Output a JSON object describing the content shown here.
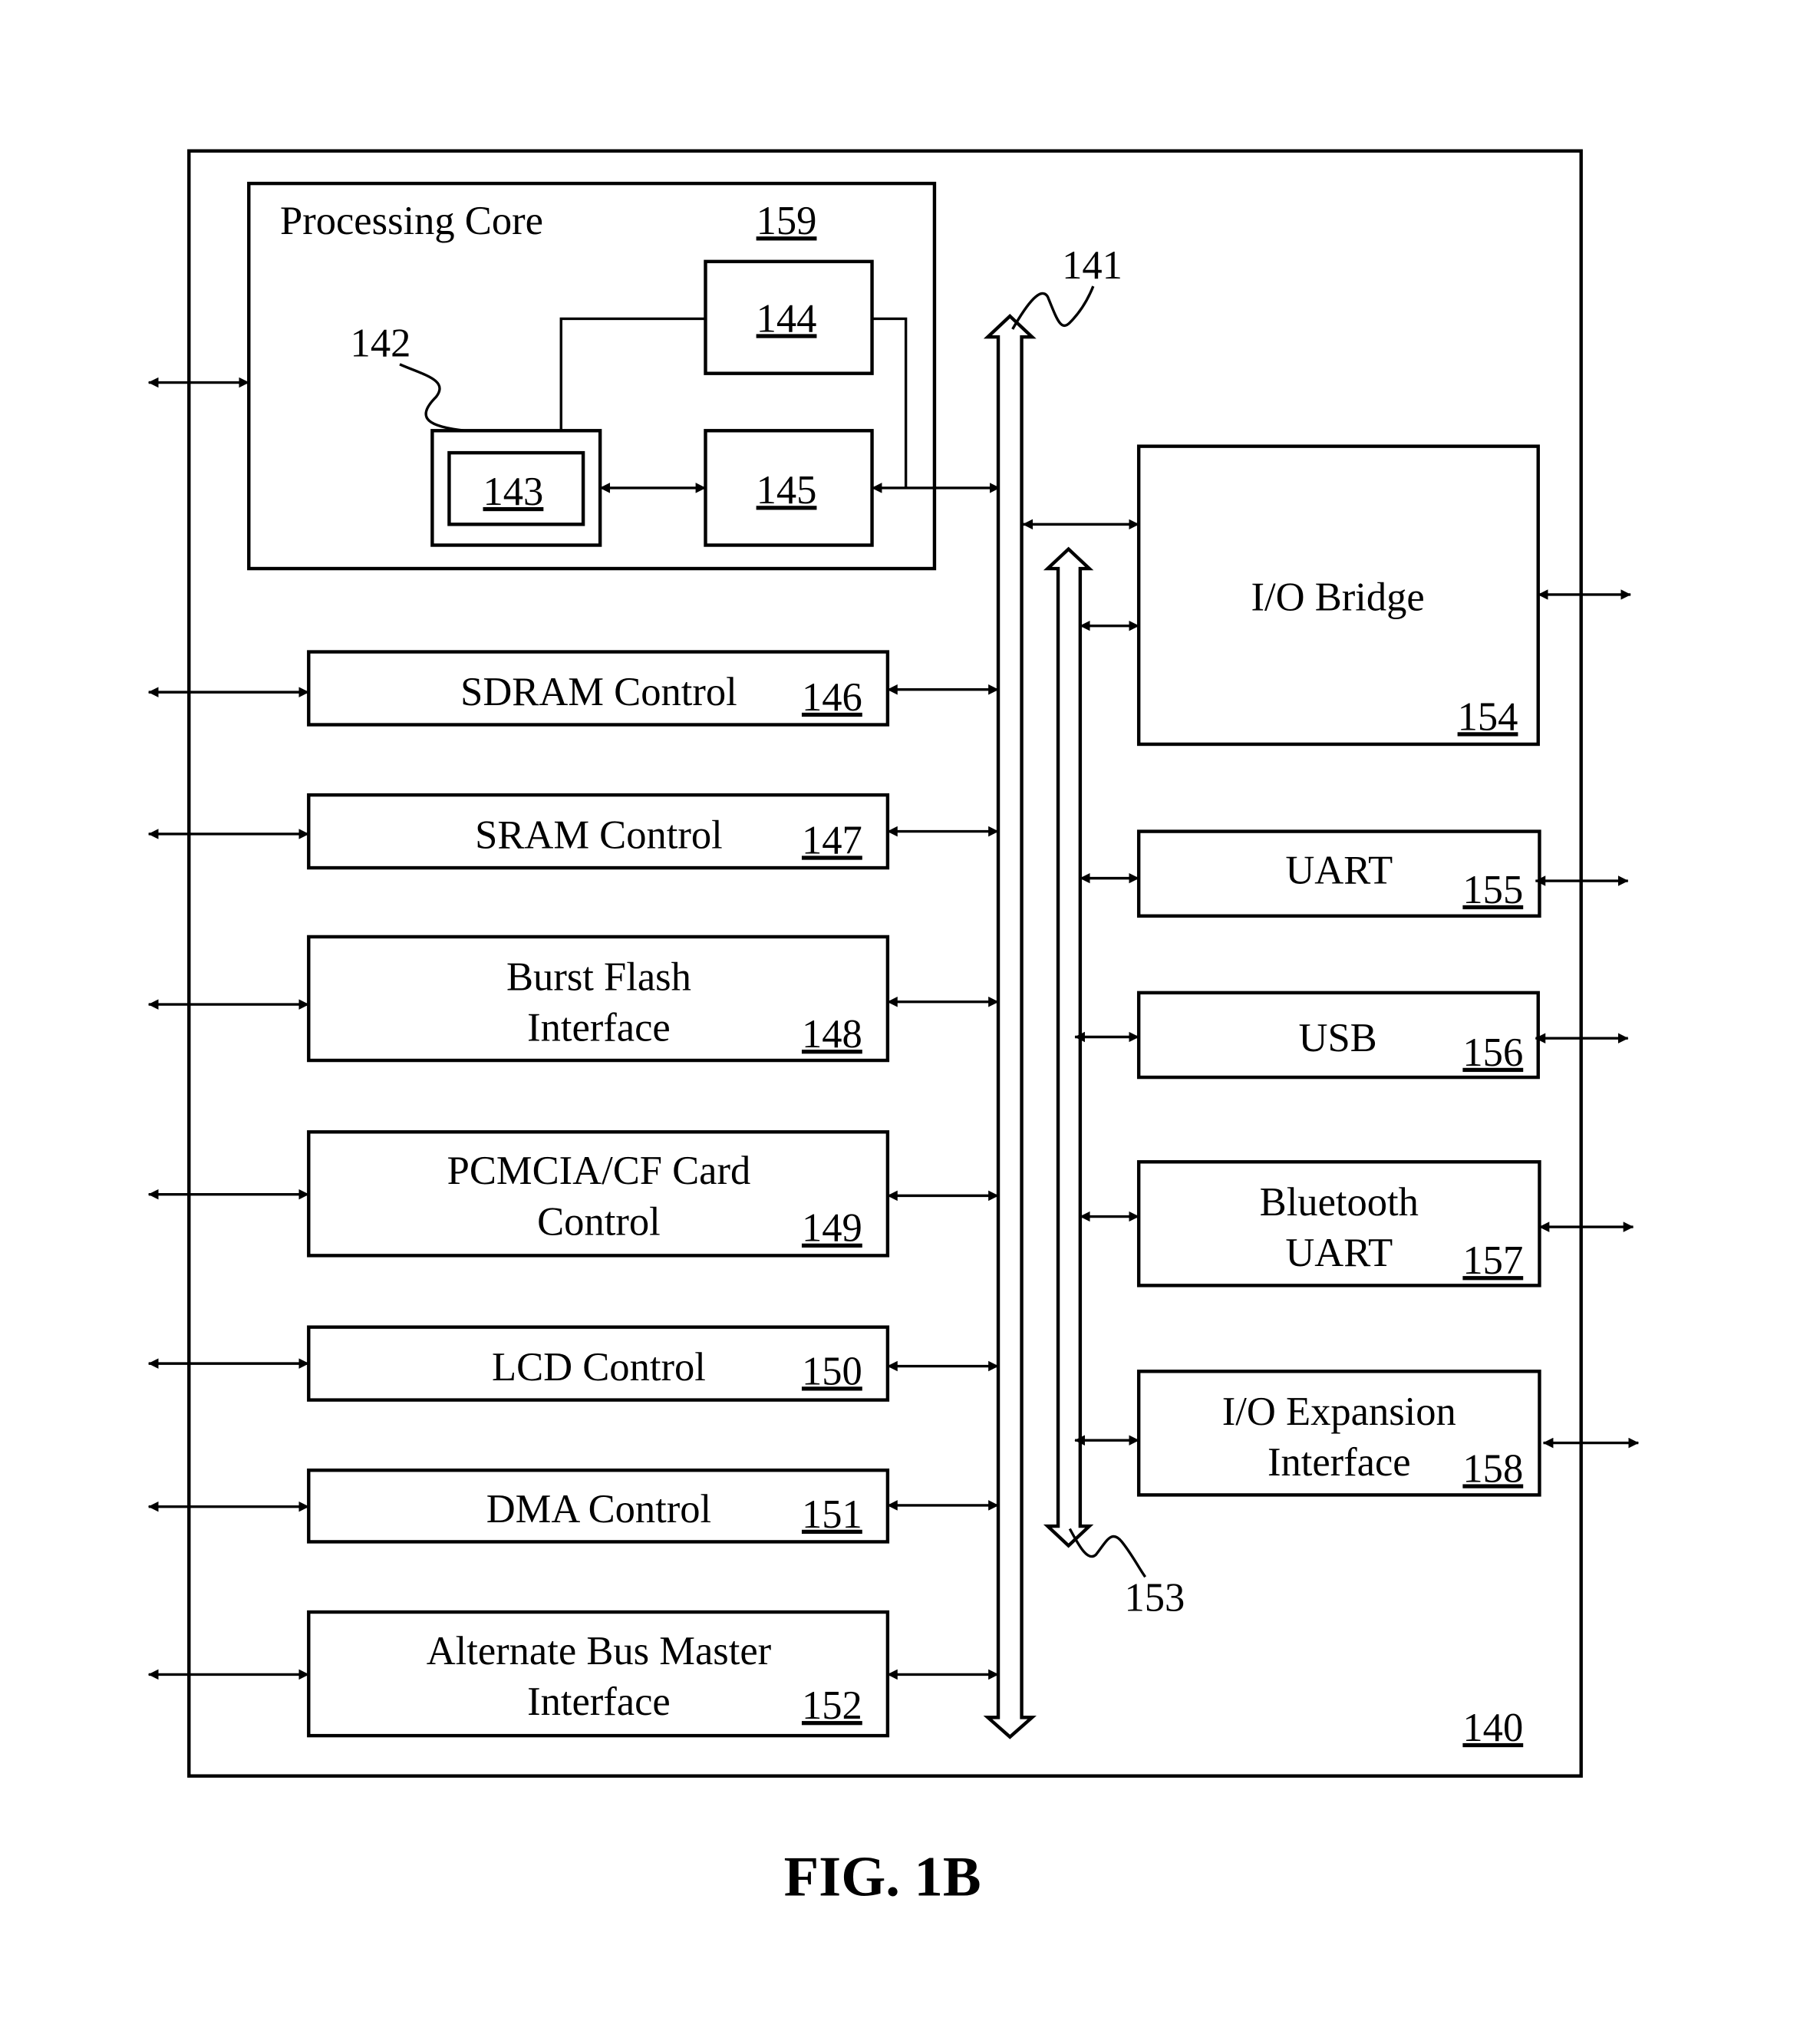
{
  "figure": {
    "caption": "FIG. 1B",
    "system_ref": "140"
  },
  "processing_core": {
    "label": "Processing Core",
    "ref": "159",
    "callout_142": "142",
    "block_143": "143",
    "block_144": "144",
    "block_145": "145"
  },
  "buses": {
    "main_bus_ref": "141",
    "io_bus_ref": "153"
  },
  "left_blocks": [
    {
      "line1": "SDRAM Control",
      "line2": "",
      "ref": "146"
    },
    {
      "line1": "SRAM Control",
      "line2": "",
      "ref": "147"
    },
    {
      "line1": "Burst Flash",
      "line2": "Interface",
      "ref": "148"
    },
    {
      "line1": "PCMCIA/CF Card",
      "line2": "Control",
      "ref": "149"
    },
    {
      "line1": "LCD Control",
      "line2": "",
      "ref": "150"
    },
    {
      "line1": "DMA Control",
      "line2": "",
      "ref": "151"
    },
    {
      "line1": "Alternate Bus Master",
      "line2": "Interface",
      "ref": "152"
    }
  ],
  "right_blocks": [
    {
      "line1": "I/O Bridge",
      "line2": "",
      "ref": "154"
    },
    {
      "line1": "UART",
      "line2": "",
      "ref": "155"
    },
    {
      "line1": "USB",
      "line2": "",
      "ref": "156"
    },
    {
      "line1": "Bluetooth",
      "line2": "UART",
      "ref": "157"
    },
    {
      "line1": "I/O Expansion",
      "line2": "Interface",
      "ref": "158"
    }
  ]
}
